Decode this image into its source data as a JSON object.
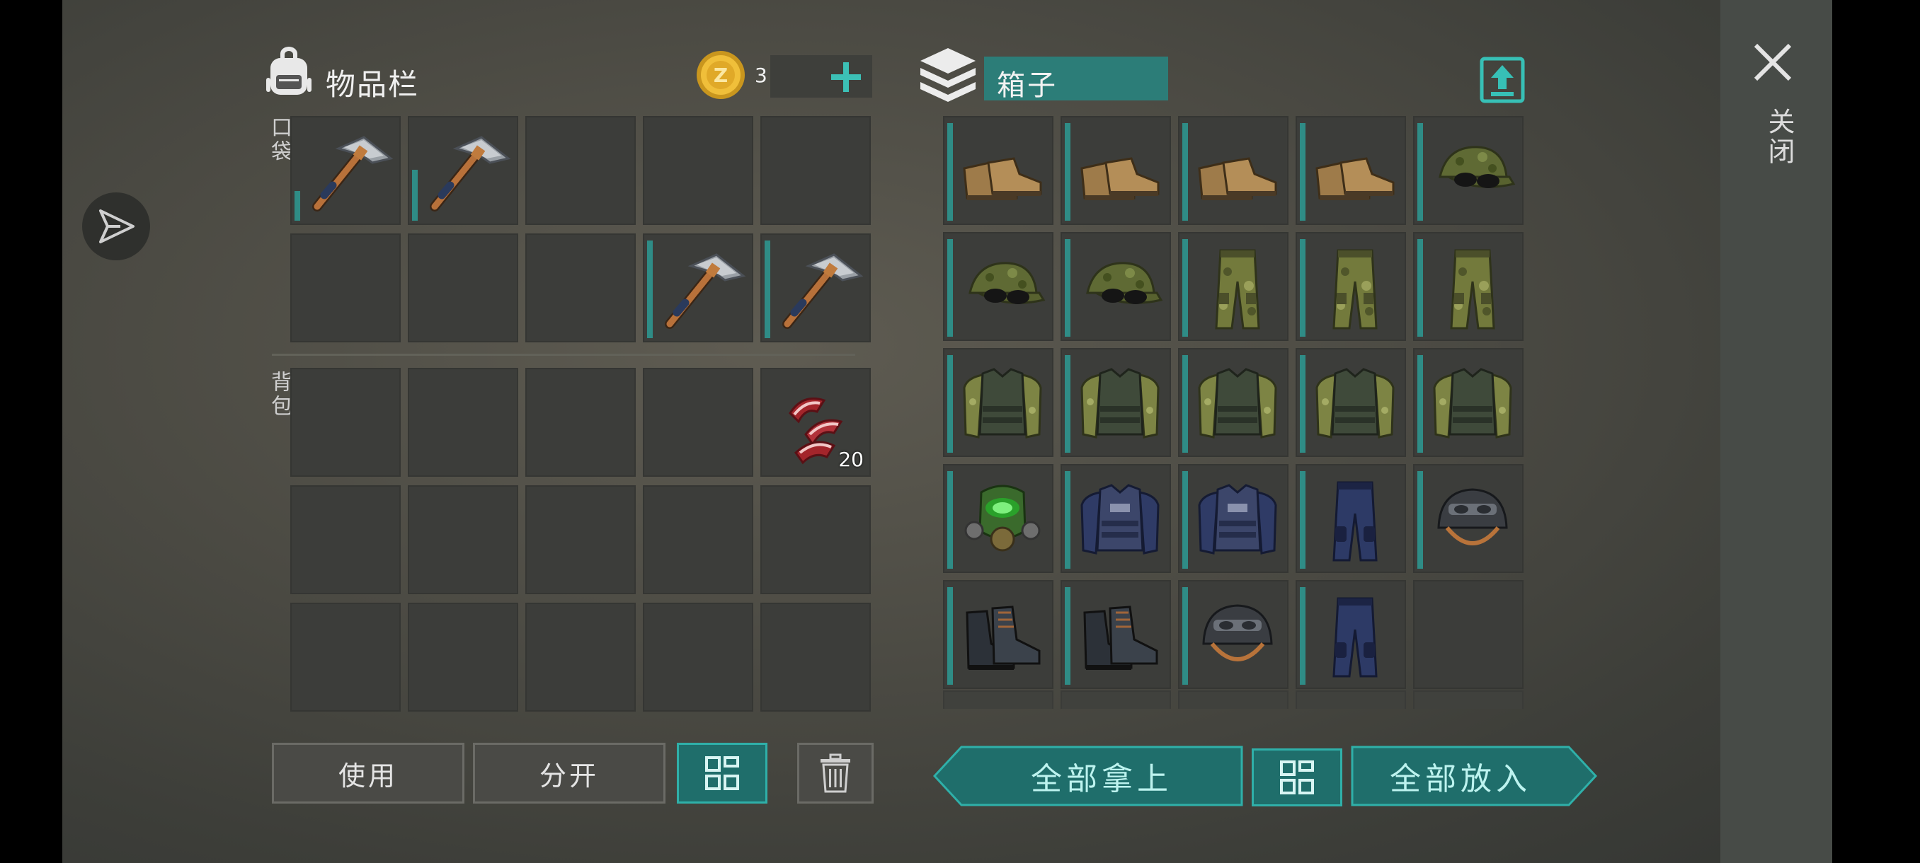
{
  "inventory": {
    "title": "物品栏",
    "coin_count": "3",
    "pocket_label": "口袋",
    "backpack_label": "背包",
    "pocket_slots": [
      "hammer-icon",
      "hammer-icon",
      "",
      "",
      "",
      "",
      "",
      "",
      "hammer-icon",
      "hammer-icon"
    ],
    "backpack_slots": [
      "",
      "",
      "",
      "",
      "meat-icon",
      "",
      "",
      "",
      "",
      "",
      "",
      "",
      "",
      "",
      ""
    ],
    "meat_qty": "20"
  },
  "box": {
    "title": "箱子"
  },
  "box_slots": [
    "boots-icon",
    "boots-icon",
    "boots-icon",
    "boots-icon",
    "cap-icon",
    "cap-icon",
    "cap-icon",
    "camo-pants-icon",
    "camo-pants-icon",
    "camo-pants-icon",
    "vest-icon",
    "vest-icon",
    "vest-icon",
    "vest-icon",
    "vest-icon",
    "gasmask-icon",
    "police-vest-icon",
    "police-vest-icon",
    "police-pants-icon",
    "helmet-icon",
    "black-boots-icon",
    "black-boots-icon",
    "helmet-icon",
    "police-pants-icon",
    ""
  ],
  "buttons": {
    "use": "使用",
    "split": "分开",
    "take_all": "全部拿上",
    "put_all": "全部放入"
  },
  "close_label": "关闭",
  "colors": {
    "accent": "#2fb0a9",
    "slot": "#3c3d3a",
    "bar": "#2f8c86"
  }
}
